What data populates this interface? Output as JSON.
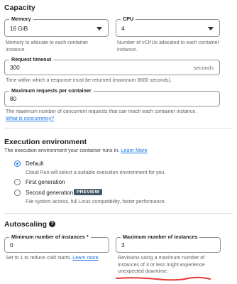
{
  "capacity": {
    "title": "Capacity",
    "memory": {
      "label": "Memory",
      "value": "16 GiB",
      "hint": "Memory to allocate to each container instance."
    },
    "cpu": {
      "label": "CPU",
      "value": "4",
      "hint": "Number of vCPUs allocated to each container instance."
    },
    "timeout": {
      "label": "Request timeout",
      "value": "300",
      "suffix": "seconds",
      "hint": "Time within which a response must be returned (maximum 3600 seconds)."
    },
    "max_requests": {
      "label": "Maximum requests per container",
      "value": "80",
      "hint": "The maximum number of concurrent requests that can reach each container instance.",
      "link": "What is concurrency?"
    }
  },
  "execution": {
    "title": "Execution environment",
    "desc": "The execution environment your container runs in.",
    "learn_more": "Learn More",
    "options": [
      {
        "label": "Default",
        "desc": "Cloud Run will select a suitable execution environment for you.",
        "checked": true
      },
      {
        "label": "First generation",
        "checked": false
      },
      {
        "label": "Second generation",
        "badge": "PREVIEW",
        "desc": "File system access, full Linux compatibility, faster performance.",
        "checked": false
      }
    ]
  },
  "autoscaling": {
    "title": "Autoscaling",
    "help_icon": "help-circle-icon",
    "min": {
      "label": "Minimum number of instances *",
      "value": "0",
      "hint_prefix": "Set to 1 to reduce cold starts.",
      "learn_more": "Learn more"
    },
    "max": {
      "label": "Maximum number of instances",
      "value": "3",
      "hint": "Revisions using a maximum number of instances of 3 or less might experience unexpected downtime."
    },
    "annotation_color": "#e53935"
  }
}
